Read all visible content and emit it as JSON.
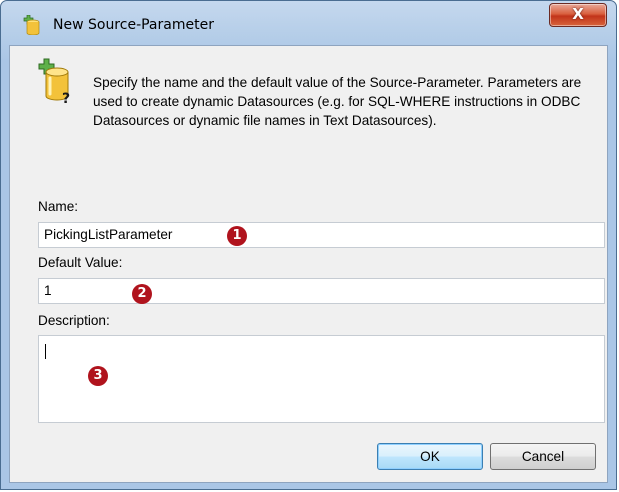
{
  "window": {
    "title": "New Source-Parameter",
    "close_symbol": "X"
  },
  "info": {
    "icon": "database-parameter-icon",
    "text": "Specify the name and the default value of the Source-Parameter. Parameters are used to create dynamic Datasources (e.g. for SQL-WHERE instructions in ODBC Datasources or dynamic file names in Text Datasources)."
  },
  "fields": {
    "name_label": "Name:",
    "name_value": "PickingListParameter",
    "default_label": "Default Value:",
    "default_value": "1",
    "description_label": "Description:",
    "description_value": ""
  },
  "annotations": {
    "marker1": "1",
    "marker2": "2",
    "marker3": "3",
    "color": "#b0131d"
  },
  "buttons": {
    "ok_label": "OK",
    "cancel_label": "Cancel"
  }
}
